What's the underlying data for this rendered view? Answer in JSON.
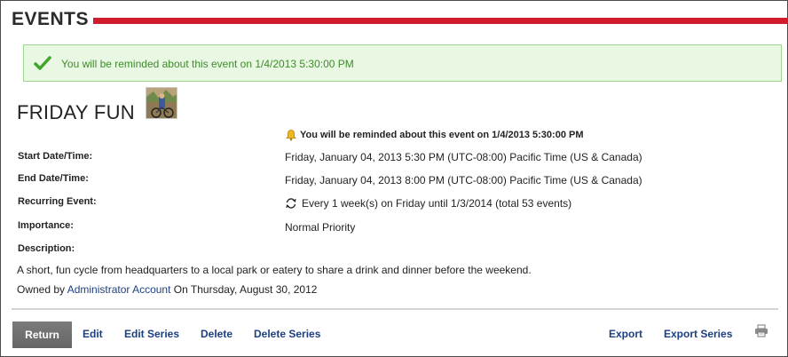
{
  "header": {
    "title": "EVENTS"
  },
  "banner": {
    "text": "You will be reminded about this event on 1/4/2013 5:30:00 PM",
    "icon": "check-icon"
  },
  "event": {
    "title": "FRIDAY FUN",
    "reminder": "You will be reminded about this event on 1/4/2013 5:30:00 PM",
    "fields": {
      "start_label": "Start Date/Time:",
      "start_value": "Friday, January 04, 2013 5:30 PM (UTC-08:00) Pacific Time (US & Canada)",
      "end_label": "End Date/Time:",
      "end_value": "Friday, January 04, 2013 8:00 PM (UTC-08:00) Pacific Time (US & Canada)",
      "recurring_label": "Recurring Event:",
      "recurring_value": "Every 1 week(s) on Friday until 1/3/2014 (total 53 events)",
      "importance_label": "Importance:",
      "importance_value": "Normal Priority",
      "description_label": "Description:"
    },
    "description": "A short, fun cycle from headquarters to a local park or eatery to share a drink and dinner before the weekend.",
    "owned_prefix": "Owned by",
    "owner": "Administrator Account",
    "owned_suffix": "On Thursday, August 30, 2012"
  },
  "actions": {
    "return": "Return",
    "edit": "Edit",
    "edit_series": "Edit Series",
    "delete": "Delete",
    "delete_series": "Delete Series",
    "export": "Export",
    "export_series": "Export Series"
  },
  "colors": {
    "accent_red": "#cf1d2d",
    "success_green": "#3f8a2b",
    "link_blue": "#1c3f82"
  }
}
